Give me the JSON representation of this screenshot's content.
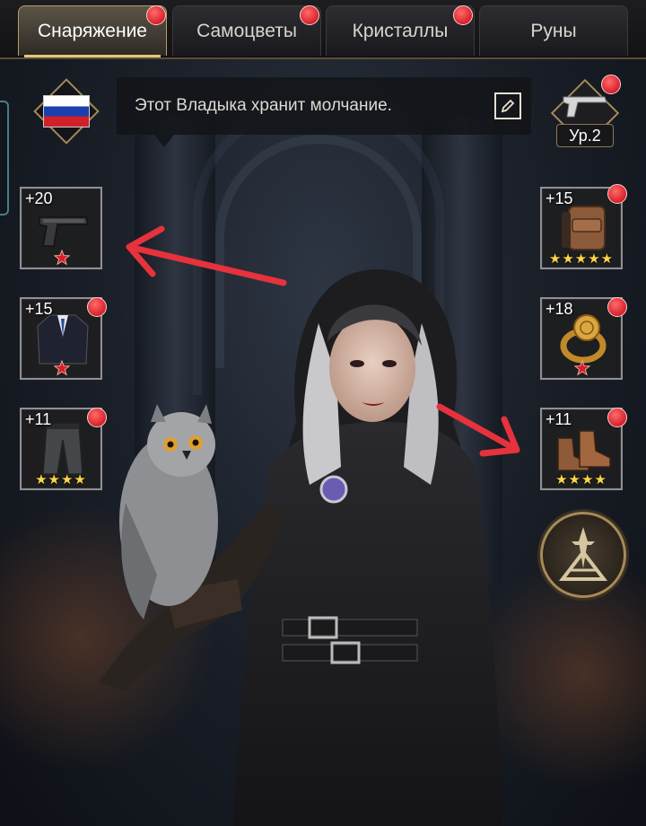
{
  "tabs": [
    {
      "label": "Снаряжение",
      "active": true,
      "notification": true
    },
    {
      "label": "Самоцветы",
      "active": false,
      "notification": true
    },
    {
      "label": "Кристаллы",
      "active": false,
      "notification": true
    },
    {
      "label": "Руны",
      "active": false,
      "notification": false
    }
  ],
  "profile": {
    "flag": "russia-flag-icon",
    "message": "Этот Владыка хранит молчание.",
    "edit_icon": "pencil-icon"
  },
  "weapon_level": {
    "label": "Ур.2",
    "icon": "pistol-icon",
    "notification": true
  },
  "slots_left": [
    {
      "level": "+20",
      "item": "pistol-icon",
      "rank": "red-star",
      "notification": false
    },
    {
      "level": "+15",
      "item": "suit-jacket-icon",
      "rank": "red-star",
      "notification": true
    },
    {
      "level": "+11",
      "item": "leather-pants-icon",
      "stars": "★★★★",
      "notification": true
    }
  ],
  "slots_right": [
    {
      "level": "+15",
      "item": "backpack-icon",
      "stars": "★★★★★",
      "notification": true
    },
    {
      "level": "+18",
      "item": "gold-ring-icon",
      "rank": "red-star",
      "notification": true
    },
    {
      "level": "+11",
      "item": "boots-icon",
      "stars": "★★★★",
      "notification": true
    }
  ],
  "emblem_icon": "dagger-emblem-icon",
  "colors": {
    "accent_gold": "#b99d62",
    "notification_red": "#d8202a",
    "annotation_red": "#e5323c",
    "star_yellow": "#ffd54a"
  }
}
